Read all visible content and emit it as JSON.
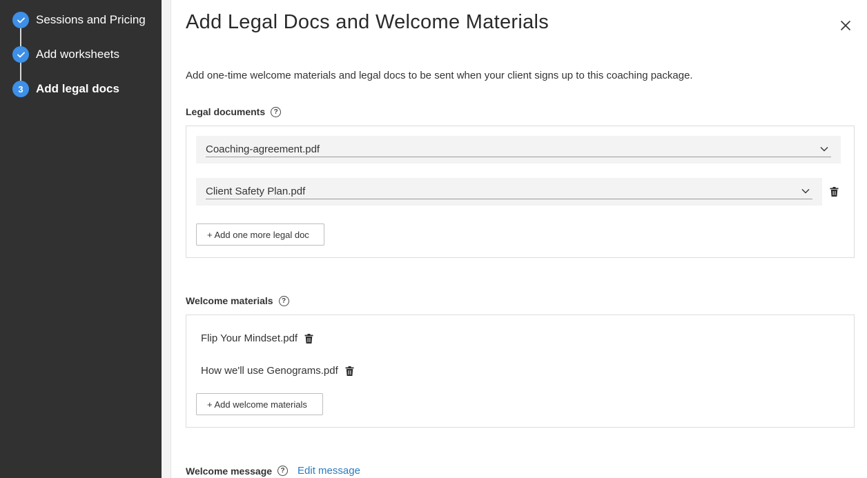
{
  "sidebar": {
    "steps": [
      {
        "label": "Sessions and Pricing",
        "status": "done",
        "icon": "check-icon"
      },
      {
        "label": "Add worksheets",
        "status": "done",
        "icon": "check-icon"
      },
      {
        "label": "Add legal docs",
        "status": "active",
        "number": "3"
      }
    ]
  },
  "header": {
    "title": "Add Legal Docs and Welcome Materials",
    "close_icon": "close-icon"
  },
  "intro": "Add one-time welcome materials and legal docs to be sent when your client signs up to this coaching package.",
  "legal": {
    "label": "Legal documents",
    "help": "?",
    "documents": [
      {
        "value": "Coaching-agreement.pdf"
      },
      {
        "value": "Client Safety Plan.pdf"
      }
    ],
    "add_button": "+ Add one more legal doc"
  },
  "welcome": {
    "label": "Welcome materials",
    "help": "?",
    "files": [
      {
        "name": "Flip Your Mindset.pdf"
      },
      {
        "name": "How we'll use Genograms.pdf"
      }
    ],
    "add_button": "+ Add welcome materials"
  },
  "message": {
    "label": "Welcome message",
    "help": "?",
    "edit_link": "Edit message"
  },
  "colors": {
    "sidebar_bg": "#313131",
    "accent": "#3d8fe8",
    "link": "#2a7bbf"
  }
}
